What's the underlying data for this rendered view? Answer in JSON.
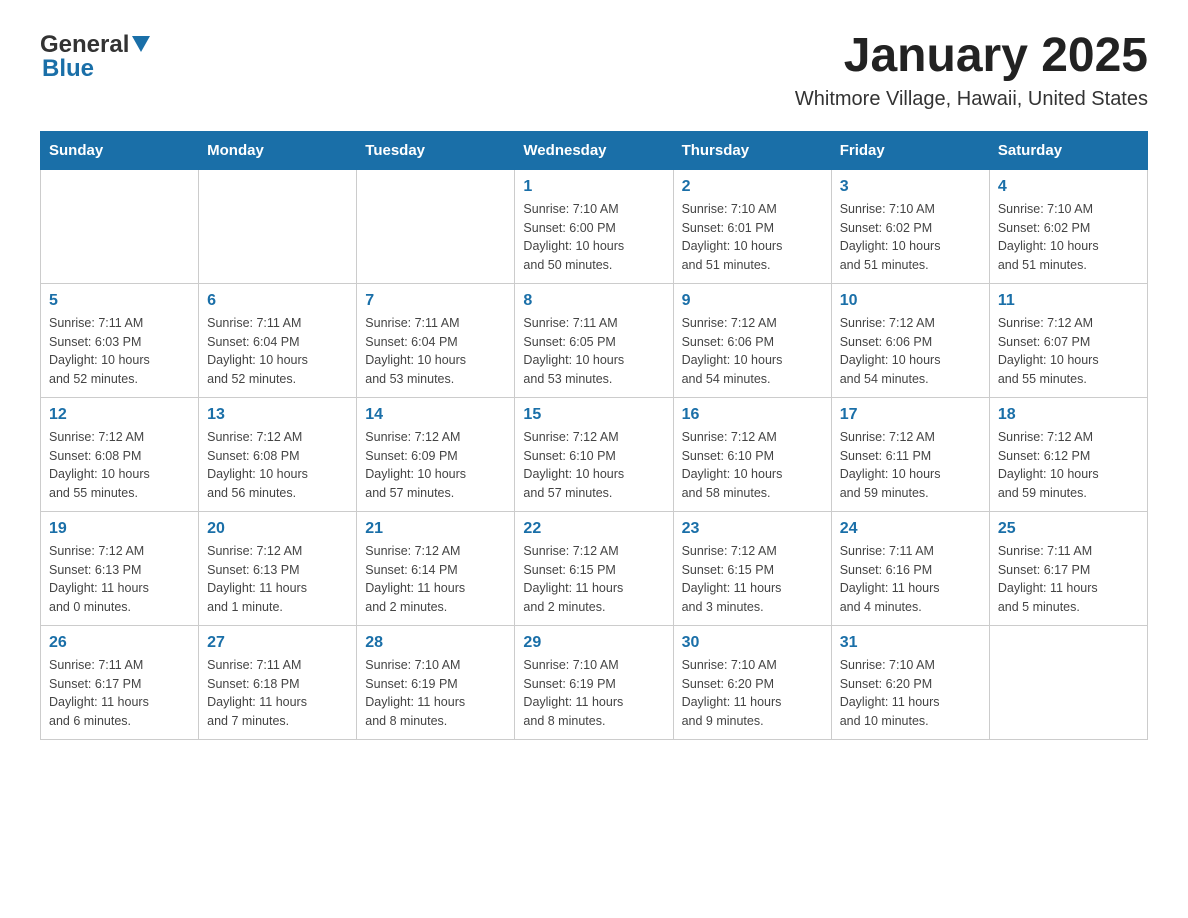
{
  "header": {
    "logo_general": "General",
    "logo_blue": "Blue",
    "title": "January 2025",
    "subtitle": "Whitmore Village, Hawaii, United States"
  },
  "days_of_week": [
    "Sunday",
    "Monday",
    "Tuesday",
    "Wednesday",
    "Thursday",
    "Friday",
    "Saturday"
  ],
  "weeks": [
    [
      {
        "day": "",
        "info": ""
      },
      {
        "day": "",
        "info": ""
      },
      {
        "day": "",
        "info": ""
      },
      {
        "day": "1",
        "info": "Sunrise: 7:10 AM\nSunset: 6:00 PM\nDaylight: 10 hours\nand 50 minutes."
      },
      {
        "day": "2",
        "info": "Sunrise: 7:10 AM\nSunset: 6:01 PM\nDaylight: 10 hours\nand 51 minutes."
      },
      {
        "day": "3",
        "info": "Sunrise: 7:10 AM\nSunset: 6:02 PM\nDaylight: 10 hours\nand 51 minutes."
      },
      {
        "day": "4",
        "info": "Sunrise: 7:10 AM\nSunset: 6:02 PM\nDaylight: 10 hours\nand 51 minutes."
      }
    ],
    [
      {
        "day": "5",
        "info": "Sunrise: 7:11 AM\nSunset: 6:03 PM\nDaylight: 10 hours\nand 52 minutes."
      },
      {
        "day": "6",
        "info": "Sunrise: 7:11 AM\nSunset: 6:04 PM\nDaylight: 10 hours\nand 52 minutes."
      },
      {
        "day": "7",
        "info": "Sunrise: 7:11 AM\nSunset: 6:04 PM\nDaylight: 10 hours\nand 53 minutes."
      },
      {
        "day": "8",
        "info": "Sunrise: 7:11 AM\nSunset: 6:05 PM\nDaylight: 10 hours\nand 53 minutes."
      },
      {
        "day": "9",
        "info": "Sunrise: 7:12 AM\nSunset: 6:06 PM\nDaylight: 10 hours\nand 54 minutes."
      },
      {
        "day": "10",
        "info": "Sunrise: 7:12 AM\nSunset: 6:06 PM\nDaylight: 10 hours\nand 54 minutes."
      },
      {
        "day": "11",
        "info": "Sunrise: 7:12 AM\nSunset: 6:07 PM\nDaylight: 10 hours\nand 55 minutes."
      }
    ],
    [
      {
        "day": "12",
        "info": "Sunrise: 7:12 AM\nSunset: 6:08 PM\nDaylight: 10 hours\nand 55 minutes."
      },
      {
        "day": "13",
        "info": "Sunrise: 7:12 AM\nSunset: 6:08 PM\nDaylight: 10 hours\nand 56 minutes."
      },
      {
        "day": "14",
        "info": "Sunrise: 7:12 AM\nSunset: 6:09 PM\nDaylight: 10 hours\nand 57 minutes."
      },
      {
        "day": "15",
        "info": "Sunrise: 7:12 AM\nSunset: 6:10 PM\nDaylight: 10 hours\nand 57 minutes."
      },
      {
        "day": "16",
        "info": "Sunrise: 7:12 AM\nSunset: 6:10 PM\nDaylight: 10 hours\nand 58 minutes."
      },
      {
        "day": "17",
        "info": "Sunrise: 7:12 AM\nSunset: 6:11 PM\nDaylight: 10 hours\nand 59 minutes."
      },
      {
        "day": "18",
        "info": "Sunrise: 7:12 AM\nSunset: 6:12 PM\nDaylight: 10 hours\nand 59 minutes."
      }
    ],
    [
      {
        "day": "19",
        "info": "Sunrise: 7:12 AM\nSunset: 6:13 PM\nDaylight: 11 hours\nand 0 minutes."
      },
      {
        "day": "20",
        "info": "Sunrise: 7:12 AM\nSunset: 6:13 PM\nDaylight: 11 hours\nand 1 minute."
      },
      {
        "day": "21",
        "info": "Sunrise: 7:12 AM\nSunset: 6:14 PM\nDaylight: 11 hours\nand 2 minutes."
      },
      {
        "day": "22",
        "info": "Sunrise: 7:12 AM\nSunset: 6:15 PM\nDaylight: 11 hours\nand 2 minutes."
      },
      {
        "day": "23",
        "info": "Sunrise: 7:12 AM\nSunset: 6:15 PM\nDaylight: 11 hours\nand 3 minutes."
      },
      {
        "day": "24",
        "info": "Sunrise: 7:11 AM\nSunset: 6:16 PM\nDaylight: 11 hours\nand 4 minutes."
      },
      {
        "day": "25",
        "info": "Sunrise: 7:11 AM\nSunset: 6:17 PM\nDaylight: 11 hours\nand 5 minutes."
      }
    ],
    [
      {
        "day": "26",
        "info": "Sunrise: 7:11 AM\nSunset: 6:17 PM\nDaylight: 11 hours\nand 6 minutes."
      },
      {
        "day": "27",
        "info": "Sunrise: 7:11 AM\nSunset: 6:18 PM\nDaylight: 11 hours\nand 7 minutes."
      },
      {
        "day": "28",
        "info": "Sunrise: 7:10 AM\nSunset: 6:19 PM\nDaylight: 11 hours\nand 8 minutes."
      },
      {
        "day": "29",
        "info": "Sunrise: 7:10 AM\nSunset: 6:19 PM\nDaylight: 11 hours\nand 8 minutes."
      },
      {
        "day": "30",
        "info": "Sunrise: 7:10 AM\nSunset: 6:20 PM\nDaylight: 11 hours\nand 9 minutes."
      },
      {
        "day": "31",
        "info": "Sunrise: 7:10 AM\nSunset: 6:20 PM\nDaylight: 11 hours\nand 10 minutes."
      },
      {
        "day": "",
        "info": ""
      }
    ]
  ]
}
